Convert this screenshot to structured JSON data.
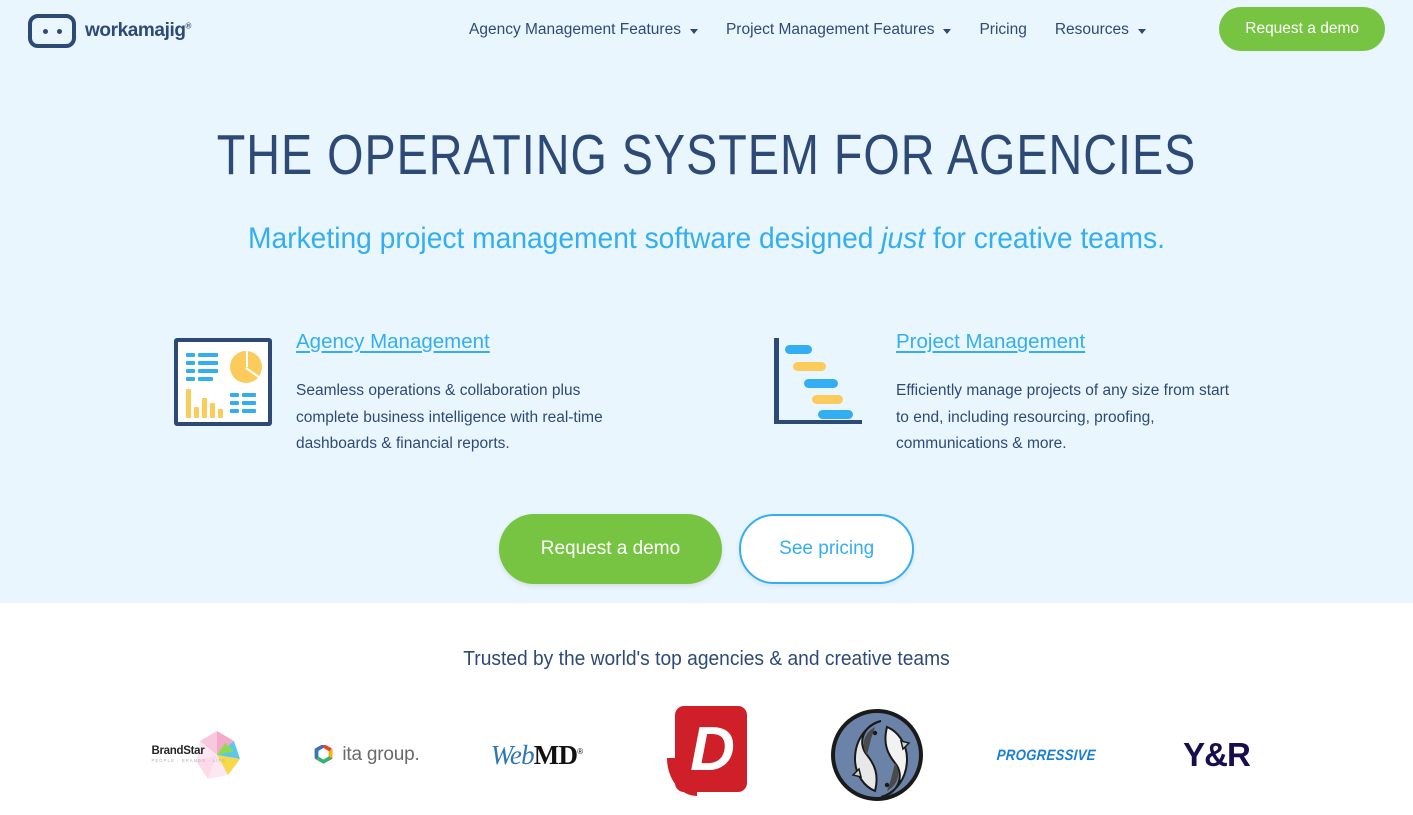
{
  "colors": {
    "hero_bg": "#eaf6fd",
    "page_bg": "#ffffff",
    "navy": "#2d4a77",
    "blue": "#33aef2",
    "green": "#76c442",
    "yellow": "#fbcb5c",
    "red": "#cf2029"
  },
  "header": {
    "logo_text": "workamajig",
    "logo_registered": "®",
    "nav_items": [
      {
        "label": "Agency Management Features",
        "has_caret": true,
        "icon": "chevron-down-icon"
      },
      {
        "label": "Project Management Features",
        "has_caret": true,
        "icon": "chevron-down-icon"
      },
      {
        "label": "Pricing",
        "has_caret": false,
        "icon": ""
      },
      {
        "label": "Resources",
        "has_caret": true,
        "icon": "chevron-down-icon"
      }
    ],
    "demo_button": "Request a demo"
  },
  "hero": {
    "headline": "THE OPERATING SYSTEM FOR AGENCIES",
    "subhead_before": "Marketing project management software designed ",
    "subhead_italic": "just",
    "subhead_after": " for creative teams.",
    "features": [
      {
        "icon": "dashboard-report-icon",
        "title": "Agency Management",
        "description": "Seamless operations & collaboration plus complete business intelligence with real-time dashboards & financial reports."
      },
      {
        "icon": "gantt-chart-icon",
        "title": "Project Management",
        "description": "Efficiently manage projects of any size from start to end, including resourcing, proofing, communications & more."
      }
    ],
    "primary_cta": "Request a demo",
    "secondary_cta": "See pricing"
  },
  "trusted": {
    "title": "Trusted by the world's top agencies & and creative teams",
    "logos": [
      {
        "name": "brandstar-logo",
        "text": "BrandStar",
        "tagline": "PEOPLE · BRANDS · LIFE"
      },
      {
        "name": "ita-group-logo",
        "text": "ita group."
      },
      {
        "name": "webmd-logo",
        "text_part1": "Web",
        "text_part2": "MD"
      },
      {
        "name": "d-bubble-logo",
        "text": "D"
      },
      {
        "name": "fish-circle-logo",
        "text": ""
      },
      {
        "name": "progressive-logo",
        "text": "PROGRESSIVE"
      },
      {
        "name": "yr-logo",
        "text": "Y&R"
      }
    ]
  }
}
